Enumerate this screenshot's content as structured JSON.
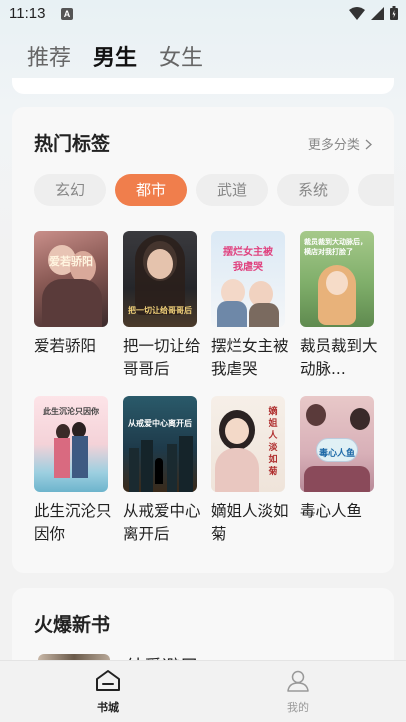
{
  "status_bar": {
    "time": "11:13",
    "notif_letter": "A"
  },
  "top_tabs": [
    {
      "label": "推荐",
      "active": false
    },
    {
      "label": "男生",
      "active": true
    },
    {
      "label": "女生",
      "active": false
    }
  ],
  "hot_tags": {
    "title": "热门标签",
    "more": "更多分类",
    "chips": [
      {
        "label": "玄幻",
        "active": false
      },
      {
        "label": "都市",
        "active": true
      },
      {
        "label": "武道",
        "active": false
      },
      {
        "label": "系统",
        "active": false
      },
      {
        "label": "",
        "active": false
      }
    ],
    "books": [
      {
        "title": "爱若骄阳",
        "cover_text": "爱若骄阳"
      },
      {
        "title": "把一切让给哥哥后",
        "cover_text": "把一切让给哥哥后"
      },
      {
        "title": "摆烂女主被我虐哭",
        "cover_text": "摆烂女主被我虐哭"
      },
      {
        "title": "裁员裁到大动脉...",
        "cover_text": "裁员裁到大动脉后，横店对我打脸了"
      },
      {
        "title": "此生沉沦只因你",
        "cover_text": "此生沉沦只因你"
      },
      {
        "title": "从戒爱中心离开后",
        "cover_text": "从戒爱中心离开后"
      },
      {
        "title": "嫡姐人淡如菊",
        "cover_text": "嫡姐人淡如菊"
      },
      {
        "title": "毒心人鱼",
        "cover_text": "毒心人鱼"
      }
    ]
  },
  "new_books": {
    "title": "火爆新书",
    "first_book_title_partial": "纯爱避居"
  },
  "bottom_nav": [
    {
      "label": "书城",
      "active": true,
      "icon": "bookstore-icon"
    },
    {
      "label": "我的",
      "active": false,
      "icon": "profile-icon"
    }
  ]
}
